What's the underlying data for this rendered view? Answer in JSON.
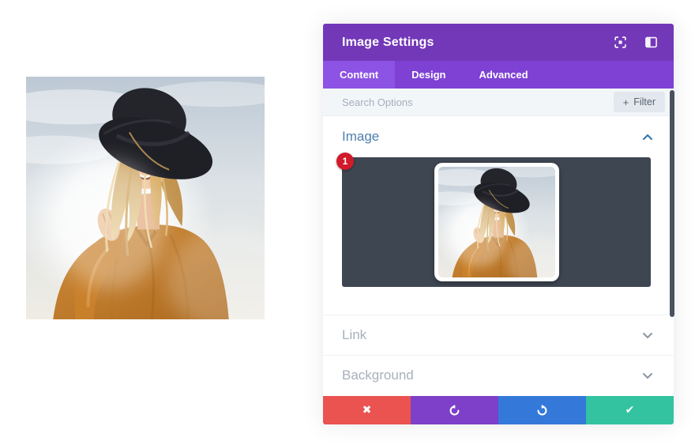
{
  "modal": {
    "title": "Image Settings",
    "header_icons": [
      {
        "name": "focus-frame-icon"
      },
      {
        "name": "split-view-icon"
      }
    ]
  },
  "tabs": [
    {
      "label": "Content",
      "active": true
    },
    {
      "label": "Design",
      "active": false
    },
    {
      "label": "Advanced",
      "active": false
    }
  ],
  "search": {
    "placeholder": "Search Options",
    "filter_icon": "+",
    "filter_label": "Filter"
  },
  "sections": {
    "image": {
      "label": "Image",
      "state": "expanded",
      "badge": "1",
      "chevron": "chevron-up"
    },
    "link": {
      "label": "Link",
      "state": "collapsed",
      "chevron": "chevron-down"
    },
    "background": {
      "label": "Background",
      "state": "collapsed",
      "chevron": "chevron-down"
    }
  },
  "footer": {
    "buttons": [
      {
        "name": "discard",
        "icon": "close-x",
        "glyph": "✖",
        "color": "#ea5350"
      },
      {
        "name": "undo",
        "icon": "undo-arrow",
        "color": "#7e3fc9"
      },
      {
        "name": "redo",
        "icon": "redo-arrow",
        "color": "#3479da"
      },
      {
        "name": "confirm",
        "icon": "checkmark",
        "glyph": "✔",
        "color": "#33c3a0"
      }
    ]
  },
  "photo": {
    "alt": "Smiling woman in a black wide-brim hat and mustard knit sweater against a bright hazy sky"
  },
  "colors": {
    "header_purple": "#7338b8",
    "tabbar_purple": "#7e41d4",
    "active_tab_purple": "#8d53e4",
    "search_bg": "#f3f6f9",
    "open_title_blue": "#4e7fad",
    "closed_title_gray": "#a7b0bb",
    "preview_bg": "#3e4651",
    "badge_red": "#d11a2a",
    "scrollbar": "#49525f"
  }
}
